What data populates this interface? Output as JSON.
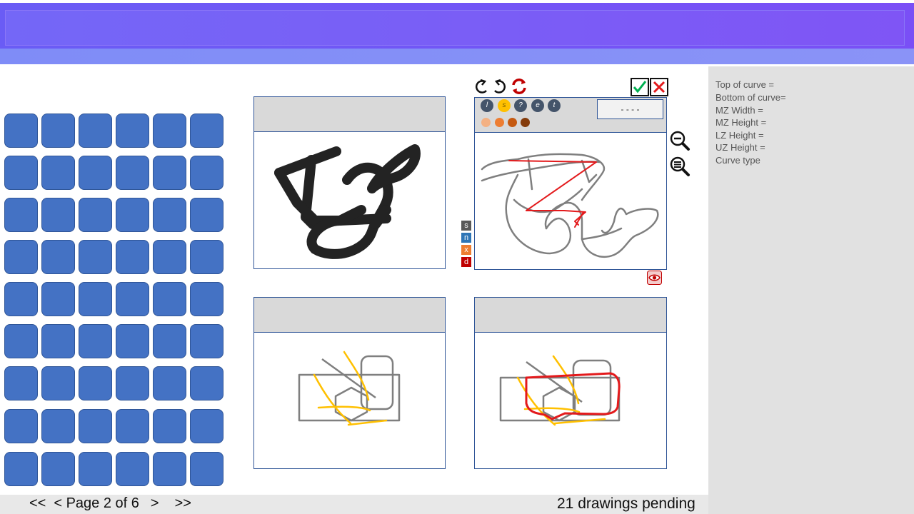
{
  "info": {
    "lines": [
      "Top of curve =",
      "Bottom of curve=",
      "MZ Width =",
      "MZ Height =",
      "LZ Height =",
      "UZ  Height =",
      "Curve type"
    ]
  },
  "pager": {
    "first": "<<",
    "prev": "< Page 2 of 6",
    "next": ">",
    "last": ">>"
  },
  "status": {
    "pending": "21 drawings pending"
  },
  "toolbar": {
    "tools": [
      "l",
      "s",
      "?",
      "e",
      "t"
    ],
    "selected_tool": "s",
    "dash_label": "- - - -",
    "colors": [
      "#f4b183",
      "#ed7d31",
      "#c55a11",
      "#843c0c"
    ]
  },
  "side_buttons": [
    {
      "label": "s",
      "color": "#595959"
    },
    {
      "label": "n",
      "color": "#2e75b6"
    },
    {
      "label": "x",
      "color": "#ed7d31"
    },
    {
      "label": "d",
      "color": "#c00000"
    }
  ],
  "icons": {
    "undo": "undo-icon",
    "redo": "redo-icon",
    "refresh": "refresh-icon",
    "accept": "check-icon",
    "reject": "close-icon",
    "zoom_out": "zoom-out-icon",
    "zoom_list": "zoom-list-icon",
    "view": "eye-icon"
  },
  "colors": {
    "accent": "#4472c4",
    "border": "#2f5597",
    "header": "#7467f7",
    "stroke_gray": "#7f7f7f",
    "stroke_red": "#e31a1c",
    "stroke_yellow": "#ffc000"
  },
  "grid": {
    "rows": 9,
    "cols": 6
  }
}
